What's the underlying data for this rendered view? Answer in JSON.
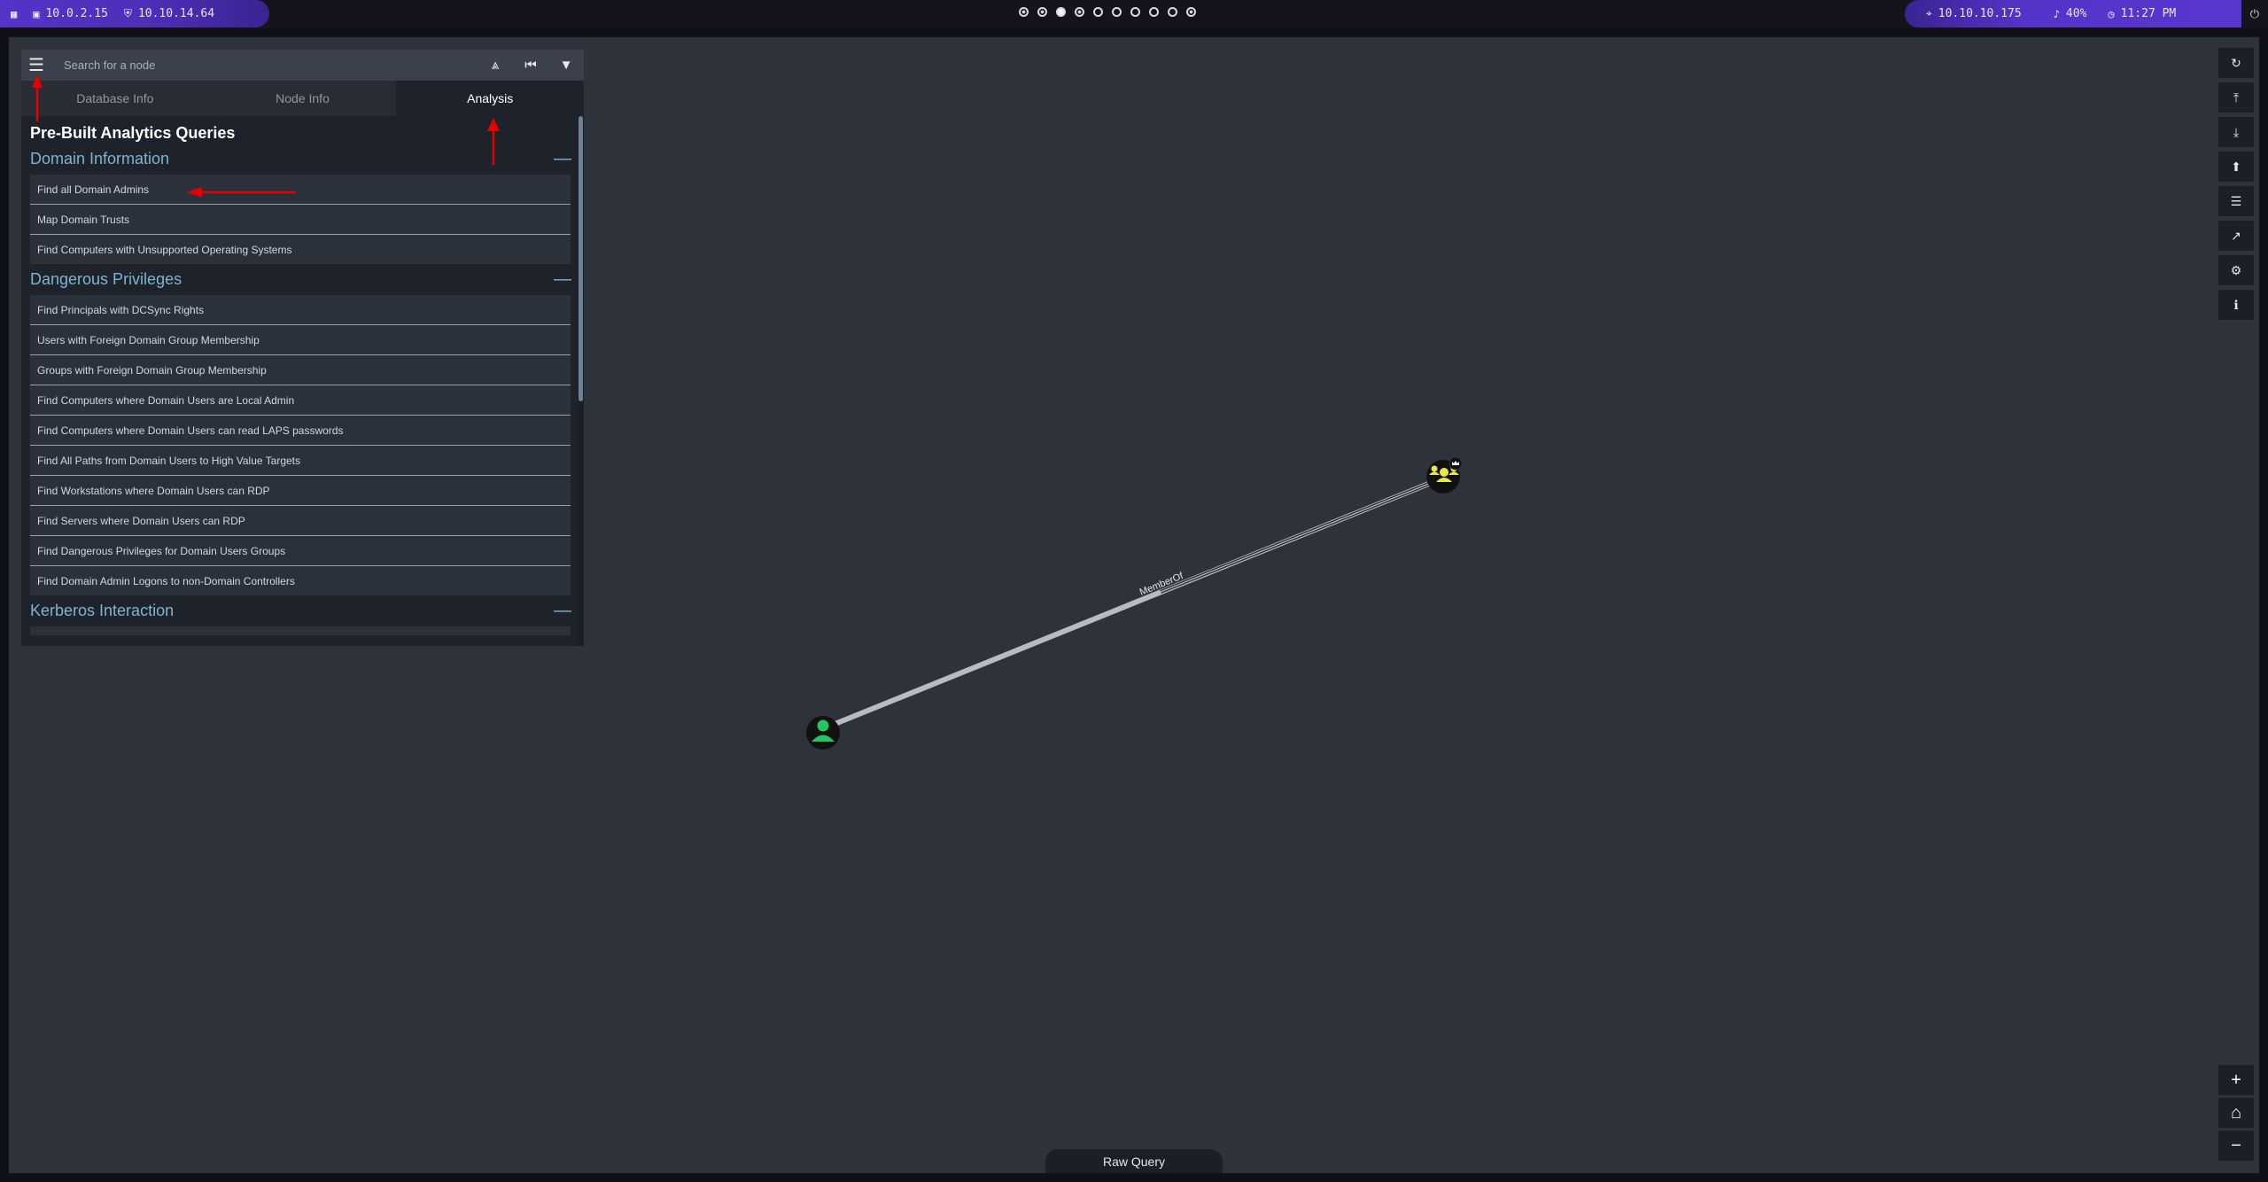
{
  "topbar": {
    "left_items": [
      {
        "icon": "grid-icon",
        "label": ""
      },
      {
        "icon": "monitor-icon",
        "label": "10.0.2.15"
      },
      {
        "icon": "shield-icon",
        "label": "10.10.14.64"
      }
    ],
    "right_items": [
      {
        "icon": "target-icon",
        "label": "10.10.10.175"
      },
      {
        "icon": "volume-icon",
        "label": "40%"
      },
      {
        "icon": "clock-icon",
        "label": "11:27 PM"
      }
    ],
    "workspaces": [
      "dot",
      "dot",
      "active",
      "dot",
      "empty",
      "empty",
      "empty",
      "empty",
      "empty",
      "dot"
    ]
  },
  "search": {
    "placeholder": "Search for a node"
  },
  "tabs": [
    "Database Info",
    "Node Info",
    "Analysis"
  ],
  "active_tab": "Analysis",
  "analysis": {
    "title": "Pre-Built Analytics Queries",
    "sections": [
      {
        "title": "Domain Information",
        "toggle": "—",
        "queries": [
          "Find all Domain Admins",
          "Map Domain Trusts",
          "Find Computers with Unsupported Operating Systems"
        ]
      },
      {
        "title": "Dangerous Privileges",
        "toggle": "—",
        "queries": [
          "Find Principals with DCSync Rights",
          "Users with Foreign Domain Group Membership",
          "Groups with Foreign Domain Group Membership",
          "Find Computers where Domain Users are Local Admin",
          "Find Computers where Domain Users can read LAPS passwords",
          "Find All Paths from Domain Users to High Value Targets",
          "Find Workstations where Domain Users can RDP",
          "Find Servers where Domain Users can RDP",
          "Find Dangerous Privileges for Domain Users Groups",
          "Find Domain Admin Logons to non-Domain Controllers"
        ]
      },
      {
        "title": "Kerberos Interaction",
        "toggle": "—",
        "queries": []
      }
    ]
  },
  "graph": {
    "edge_label": "MemberOf",
    "nodes": [
      {
        "type": "user",
        "color": "#22c55e"
      },
      {
        "type": "group",
        "color": "#e8e84a",
        "badge": "crown-icon"
      }
    ]
  },
  "right_toolbar": [
    "refresh-icon",
    "upload-icon",
    "download-icon",
    "import-icon",
    "list-icon",
    "chart-icon",
    "settings-icon",
    "info-icon"
  ],
  "zoom_toolbar": [
    "zoom-in-icon",
    "home-icon",
    "zoom-out-icon"
  ],
  "raw_query": {
    "label": "Raw Query"
  },
  "colors": {
    "accent": "#5533c9",
    "section": "#7fb3d1",
    "annotation": "#e60000"
  }
}
